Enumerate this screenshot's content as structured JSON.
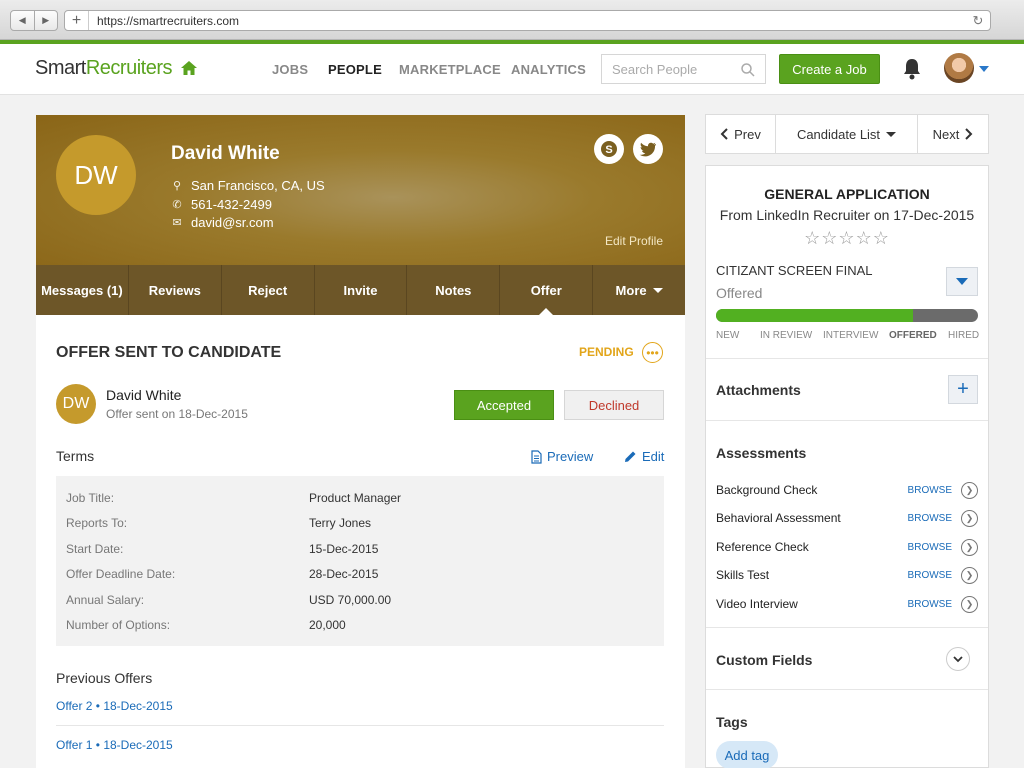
{
  "browser": {
    "url": "https://smartrecruiters.com"
  },
  "header": {
    "logo_part1": "Smart",
    "logo_part2": "Recruiters",
    "nav": [
      "JOBS",
      "PEOPLE",
      "MARKETPLACE",
      "ANALYTICS"
    ],
    "active_nav": "PEOPLE",
    "search_placeholder": "Search People",
    "create_job": "Create a Job"
  },
  "profile": {
    "initials": "DW",
    "name": "David White",
    "location": "San Francisco, CA, US",
    "phone": "561-432-2499",
    "email": "david@sr.com",
    "edit_profile": "Edit Profile",
    "tabs": [
      "Messages (1)",
      "Reviews",
      "Reject",
      "Invite",
      "Notes",
      "Offer",
      "More"
    ],
    "active_tab": "Offer"
  },
  "offer": {
    "title": "OFFER SENT TO CANDIDATE",
    "status": "PENDING",
    "candidate_initials": "DW",
    "candidate_name": "David White",
    "sent_on": "Offer sent on 18-Dec-2015",
    "accepted_label": "Accepted",
    "declined_label": "Declined",
    "terms_label": "Terms",
    "preview_label": "Preview",
    "edit_label": "Edit",
    "terms": [
      {
        "k": "Job Title:",
        "v": "Product Manager"
      },
      {
        "k": "Reports To:",
        "v": "Terry Jones"
      },
      {
        "k": "Start Date:",
        "v": "15-Dec-2015"
      },
      {
        "k": "Offer Deadline Date:",
        "v": "28-Dec-2015"
      },
      {
        "k": "Annual Salary:",
        "v": "USD 70,000.00"
      },
      {
        "k": "Number of Options:",
        "v": "20,000"
      }
    ],
    "previous_label": "Previous Offers",
    "previous": [
      "Offer 2 • 18-Dec-2015",
      "Offer 1 • 18-Dec-2015"
    ]
  },
  "pager": {
    "prev": "Prev",
    "list": "Candidate List",
    "next": "Next"
  },
  "application": {
    "title": "GENERAL APPLICATION",
    "source": "From LinkedIn Recruiter on 17-Dec-2015",
    "rating": 0,
    "rating_max": 5,
    "stage": "CITIZANT SCREEN FINAL",
    "stage_status": "Offered",
    "progress": 0.75,
    "steps": [
      "NEW",
      "IN REVIEW",
      "INTERVIEW",
      "OFFERED",
      "HIRED"
    ],
    "current_step": "OFFERED"
  },
  "attachments_label": "Attachments",
  "assessments": {
    "label": "Assessments",
    "browse_label": "BROWSE",
    "items": [
      "Background Check",
      "Behavioral Assessment",
      "Reference Check",
      "Skills Test",
      "Video Interview"
    ]
  },
  "custom_fields_label": "Custom Fields",
  "tags": {
    "label": "Tags",
    "add_label": "Add tag"
  },
  "colors": {
    "brand_green": "#5aa31f",
    "link_blue": "#1a6bb8",
    "pending_orange": "#e2a51a",
    "declined_red": "#c0392b"
  }
}
